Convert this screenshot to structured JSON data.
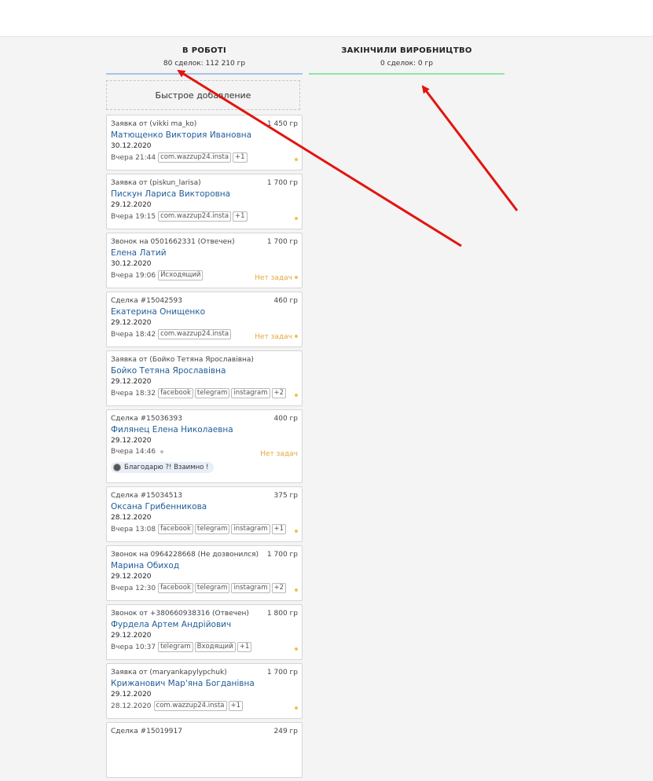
{
  "columns": [
    {
      "title": "В РОБОТІ",
      "summary": "80 сделок: 112 210 гр",
      "line_color": "#a6c3ea"
    },
    {
      "title": "ЗАКІНЧИЛИ ВИРОБНИЦТВО",
      "summary": "0 сделок: 0 гр",
      "line_color": "#8fe3a6"
    }
  ],
  "quick_add": "Быстрое добавление",
  "cards": [
    {
      "source": "Заявка от (vikki ma_ko)",
      "amount": "1 450 гр",
      "name": "Матющенко Виктория Ивановна",
      "date": "30.12.2020",
      "time": "Вчера 21:44",
      "tags": [
        "com.wazzup24.insta",
        "+1"
      ]
    },
    {
      "source": "Заявка от (piskun_larisa)",
      "amount": "1 700 гр",
      "name": "Пискун Лариса Викторовна",
      "date": "29.12.2020",
      "time": "Вчера 19:15",
      "tags": [
        "com.wazzup24.insta",
        "+1"
      ]
    },
    {
      "source": "Звонок на 0501662331 (Отвечен)",
      "amount": "1 700 гр",
      "name": "Елена Латий",
      "date": "30.12.2020",
      "time": "Вчера 19:06",
      "tags": [
        "Исходящий"
      ],
      "no_tasks": "Нет задач"
    },
    {
      "source": "Сделка #15042593",
      "amount": "460 гр",
      "name": "Екатерина Онищенко",
      "date": "29.12.2020",
      "time": "Вчера 18:42",
      "tags": [
        "com.wazzup24.insta"
      ],
      "no_tasks": "Нет задач"
    },
    {
      "source": "Заявка от (Бойко Тетяна Ярославівна)",
      "amount": "",
      "name": "Бойко Тетяна Ярославівна",
      "date": "29.12.2020",
      "time": "Вчера 18:32",
      "tags": [
        "facebook",
        "telegram",
        "instagram",
        "+2"
      ]
    },
    {
      "source": "Сделка #15036393",
      "amount": "400 гр",
      "name": "Филянец Елена Николаевна",
      "date": "29.12.2020",
      "time": "Вчера 14:46",
      "tags": [],
      "no_tasks": "Нет задач",
      "message": "Благодарю ?! Взаимно !"
    },
    {
      "source": "Сделка #15034513",
      "amount": "375 гр",
      "name": "Оксана Грибенникова",
      "date": "28.12.2020",
      "time": "Вчера 13:08",
      "tags": [
        "facebook",
        "telegram",
        "instagram",
        "+1"
      ]
    },
    {
      "source": "Звонок на 0964228668 (Не дозвонился)",
      "amount": "1 700 гр",
      "name": "Марина Обиход",
      "date": "29.12.2020",
      "time": "Вчера 12:30",
      "tags": [
        "facebook",
        "telegram",
        "instagram",
        "+2"
      ]
    },
    {
      "source": "Звонок от +380660938316 (Отвечен)",
      "amount": "1 800 гр",
      "name": "Фурдела Артем Андрійович",
      "date": "29.12.2020",
      "time": "Вчера 10:37",
      "tags": [
        "telegram",
        "Входящий",
        "+1"
      ]
    },
    {
      "source": "Заявка от (maryankapylypchuk)",
      "amount": "1 700 гр",
      "name": "Крижанович Мар'яна Богданівна",
      "date": "29.12.2020",
      "time": "28.12.2020",
      "tags": [
        "com.wazzup24.insta",
        "+1"
      ]
    },
    {
      "source": "Сделка #15019917",
      "amount": "249 гр",
      "name": "",
      "date": "",
      "time": "",
      "tags": []
    }
  ],
  "colors": {
    "accent_link": "#1f5c99",
    "arrow": "#e3140f",
    "no_tasks": "#e9a53a"
  },
  "annotations": {
    "arrows": 2
  }
}
